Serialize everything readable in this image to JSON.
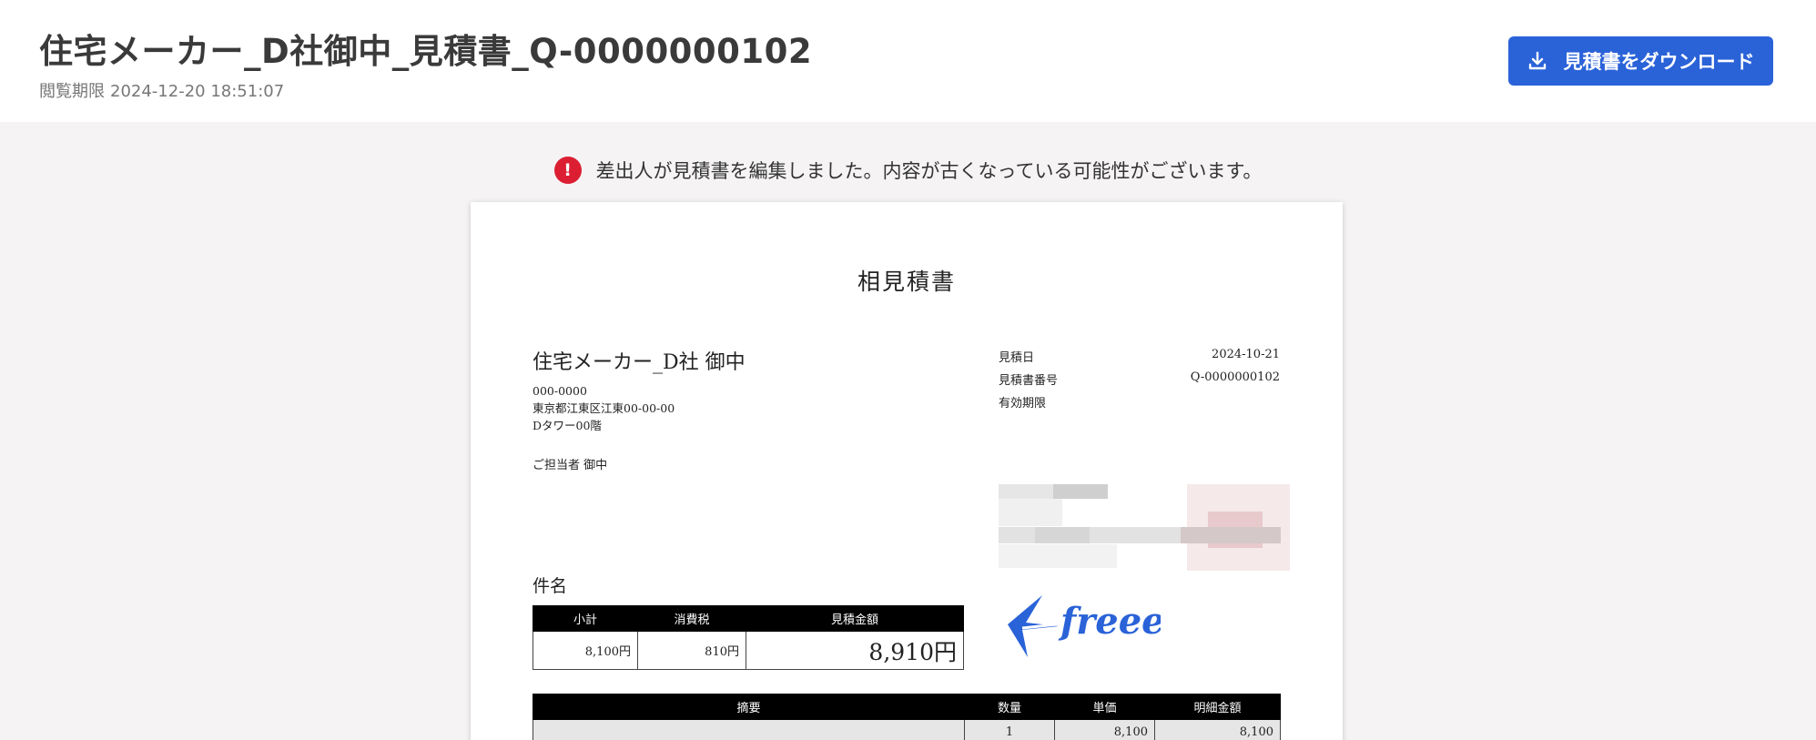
{
  "header": {
    "title": "住宅メーカー_D社御中_見積書_Q-0000000102",
    "expiry_label": "閲覧期限",
    "expiry_value": "2024-12-20 18:51:07",
    "download_label": "見積書をダウンロード"
  },
  "notice": {
    "icon_text": "!",
    "text": "差出人が見積書を編集しました。内容が古くなっている可能性がございます。"
  },
  "document": {
    "title": "相見積書",
    "recipient": {
      "name": "住宅メーカー_D社  御中",
      "postal": "000-0000",
      "address_line1": "東京都江東区江東00-00-00",
      "address_line2": "Dタワー00階",
      "contact": "ご担当者  御中"
    },
    "meta": {
      "date_label": "見積日",
      "date_value": "2024-10-21",
      "number_label": "見積書番号",
      "number_value": "Q-0000000102",
      "valid_label": "有効期限",
      "valid_value": ""
    },
    "logo_text": "freee",
    "subject_label": "件名",
    "summary": {
      "headers": [
        "小計",
        "消費税",
        "見積金額"
      ],
      "values": [
        "8,100円",
        "810円",
        "8,910円"
      ]
    },
    "items": {
      "headers": [
        "摘要",
        "数量",
        "単価",
        "明細金額"
      ],
      "rows": [
        {
          "description": "",
          "quantity": "1",
          "unit_price": "8,100",
          "amount": "8,100"
        }
      ]
    }
  },
  "colors": {
    "primary": "#2a62d8",
    "alert": "#dc1e33",
    "background": "#f5f3f3"
  }
}
